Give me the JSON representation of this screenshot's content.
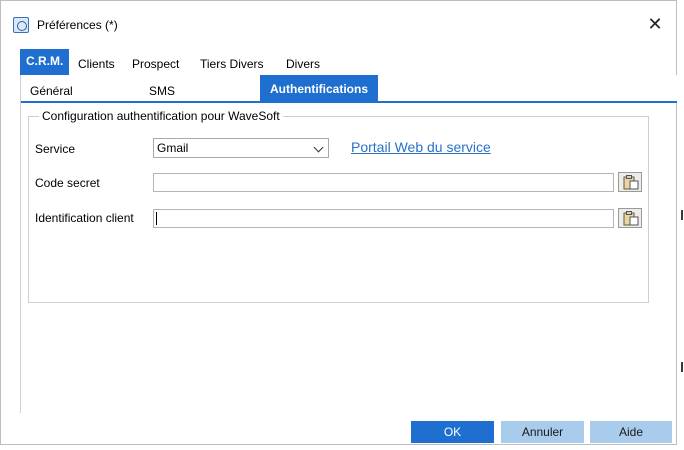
{
  "window": {
    "title": "Préférences (*)",
    "close_glyph": "✕",
    "icon": "app-icon"
  },
  "tabs_top": [
    {
      "label": "C.R.M.",
      "active": true
    },
    {
      "label": "Clients",
      "active": false
    },
    {
      "label": "Prospect",
      "active": false
    },
    {
      "label": "Tiers Divers",
      "active": false
    },
    {
      "label": "Divers",
      "active": false
    }
  ],
  "tabs_sub": [
    {
      "label": "Général",
      "active": false
    },
    {
      "label": "SMS",
      "active": false
    },
    {
      "label": "Authentifications",
      "active": true
    }
  ],
  "group": {
    "legend": "Configuration authentification pour WaveSoft",
    "service_label": "Service",
    "service_value": "Gmail",
    "service_link": "Portail Web du service",
    "secret_label": "Code secret",
    "secret_value": "",
    "client_label": "Identification client",
    "client_value": ""
  },
  "footer": {
    "ok_label": "OK",
    "cancel_label": "Annuler",
    "help_label": "Aide"
  },
  "colors": {
    "accent": "#1f6fd0",
    "secondary_button": "#a9cbec",
    "link": "#2a71c8"
  }
}
